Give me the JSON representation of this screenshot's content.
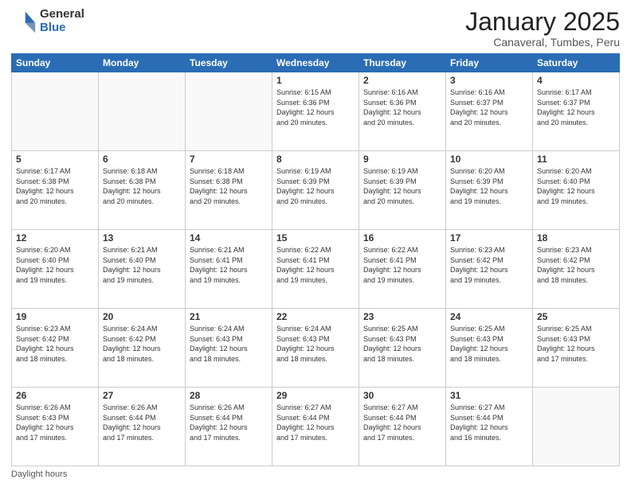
{
  "header": {
    "logo_general": "General",
    "logo_blue": "Blue",
    "month_title": "January 2025",
    "subtitle": "Canaveral, Tumbes, Peru"
  },
  "footer": {
    "daylight_label": "Daylight hours"
  },
  "days_of_week": [
    "Sunday",
    "Monday",
    "Tuesday",
    "Wednesday",
    "Thursday",
    "Friday",
    "Saturday"
  ],
  "weeks": [
    [
      {
        "num": "",
        "info": ""
      },
      {
        "num": "",
        "info": ""
      },
      {
        "num": "",
        "info": ""
      },
      {
        "num": "1",
        "info": "Sunrise: 6:15 AM\nSunset: 6:36 PM\nDaylight: 12 hours\nand 20 minutes."
      },
      {
        "num": "2",
        "info": "Sunrise: 6:16 AM\nSunset: 6:36 PM\nDaylight: 12 hours\nand 20 minutes."
      },
      {
        "num": "3",
        "info": "Sunrise: 6:16 AM\nSunset: 6:37 PM\nDaylight: 12 hours\nand 20 minutes."
      },
      {
        "num": "4",
        "info": "Sunrise: 6:17 AM\nSunset: 6:37 PM\nDaylight: 12 hours\nand 20 minutes."
      }
    ],
    [
      {
        "num": "5",
        "info": "Sunrise: 6:17 AM\nSunset: 6:38 PM\nDaylight: 12 hours\nand 20 minutes."
      },
      {
        "num": "6",
        "info": "Sunrise: 6:18 AM\nSunset: 6:38 PM\nDaylight: 12 hours\nand 20 minutes."
      },
      {
        "num": "7",
        "info": "Sunrise: 6:18 AM\nSunset: 6:38 PM\nDaylight: 12 hours\nand 20 minutes."
      },
      {
        "num": "8",
        "info": "Sunrise: 6:19 AM\nSunset: 6:39 PM\nDaylight: 12 hours\nand 20 minutes."
      },
      {
        "num": "9",
        "info": "Sunrise: 6:19 AM\nSunset: 6:39 PM\nDaylight: 12 hours\nand 20 minutes."
      },
      {
        "num": "10",
        "info": "Sunrise: 6:20 AM\nSunset: 6:39 PM\nDaylight: 12 hours\nand 19 minutes."
      },
      {
        "num": "11",
        "info": "Sunrise: 6:20 AM\nSunset: 6:40 PM\nDaylight: 12 hours\nand 19 minutes."
      }
    ],
    [
      {
        "num": "12",
        "info": "Sunrise: 6:20 AM\nSunset: 6:40 PM\nDaylight: 12 hours\nand 19 minutes."
      },
      {
        "num": "13",
        "info": "Sunrise: 6:21 AM\nSunset: 6:40 PM\nDaylight: 12 hours\nand 19 minutes."
      },
      {
        "num": "14",
        "info": "Sunrise: 6:21 AM\nSunset: 6:41 PM\nDaylight: 12 hours\nand 19 minutes."
      },
      {
        "num": "15",
        "info": "Sunrise: 6:22 AM\nSunset: 6:41 PM\nDaylight: 12 hours\nand 19 minutes."
      },
      {
        "num": "16",
        "info": "Sunrise: 6:22 AM\nSunset: 6:41 PM\nDaylight: 12 hours\nand 19 minutes."
      },
      {
        "num": "17",
        "info": "Sunrise: 6:23 AM\nSunset: 6:42 PM\nDaylight: 12 hours\nand 19 minutes."
      },
      {
        "num": "18",
        "info": "Sunrise: 6:23 AM\nSunset: 6:42 PM\nDaylight: 12 hours\nand 18 minutes."
      }
    ],
    [
      {
        "num": "19",
        "info": "Sunrise: 6:23 AM\nSunset: 6:42 PM\nDaylight: 12 hours\nand 18 minutes."
      },
      {
        "num": "20",
        "info": "Sunrise: 6:24 AM\nSunset: 6:42 PM\nDaylight: 12 hours\nand 18 minutes."
      },
      {
        "num": "21",
        "info": "Sunrise: 6:24 AM\nSunset: 6:43 PM\nDaylight: 12 hours\nand 18 minutes."
      },
      {
        "num": "22",
        "info": "Sunrise: 6:24 AM\nSunset: 6:43 PM\nDaylight: 12 hours\nand 18 minutes."
      },
      {
        "num": "23",
        "info": "Sunrise: 6:25 AM\nSunset: 6:43 PM\nDaylight: 12 hours\nand 18 minutes."
      },
      {
        "num": "24",
        "info": "Sunrise: 6:25 AM\nSunset: 6:43 PM\nDaylight: 12 hours\nand 18 minutes."
      },
      {
        "num": "25",
        "info": "Sunrise: 6:25 AM\nSunset: 6:43 PM\nDaylight: 12 hours\nand 17 minutes."
      }
    ],
    [
      {
        "num": "26",
        "info": "Sunrise: 6:26 AM\nSunset: 6:43 PM\nDaylight: 12 hours\nand 17 minutes."
      },
      {
        "num": "27",
        "info": "Sunrise: 6:26 AM\nSunset: 6:44 PM\nDaylight: 12 hours\nand 17 minutes."
      },
      {
        "num": "28",
        "info": "Sunrise: 6:26 AM\nSunset: 6:44 PM\nDaylight: 12 hours\nand 17 minutes."
      },
      {
        "num": "29",
        "info": "Sunrise: 6:27 AM\nSunset: 6:44 PM\nDaylight: 12 hours\nand 17 minutes."
      },
      {
        "num": "30",
        "info": "Sunrise: 6:27 AM\nSunset: 6:44 PM\nDaylight: 12 hours\nand 17 minutes."
      },
      {
        "num": "31",
        "info": "Sunrise: 6:27 AM\nSunset: 6:44 PM\nDaylight: 12 hours\nand 16 minutes."
      },
      {
        "num": "",
        "info": ""
      }
    ]
  ]
}
